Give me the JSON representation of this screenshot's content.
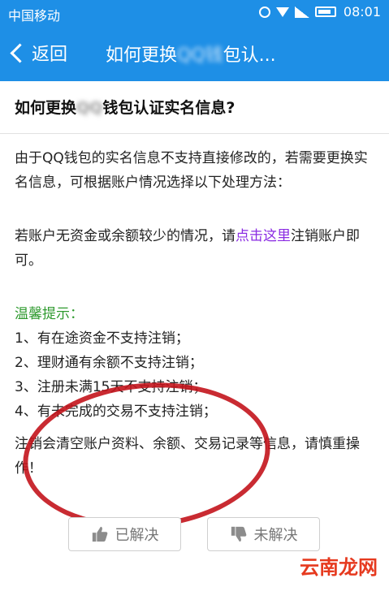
{
  "status_bar": {
    "carrier": "中国移动",
    "time": "08:01"
  },
  "nav": {
    "back_label": "返回",
    "title_pre": "如何更换",
    "title_blur": "QQ钱",
    "title_post": "包认..."
  },
  "article": {
    "title_pre": "如何更换",
    "title_blur": "QQ",
    "title_post": "钱包认证实名信息?",
    "para1": "由于QQ钱包的实名信息不支持直接修改的，若需要更换实名信息，可根据账户情况选择以下处理方法：",
    "para2_pre": "若账户无资金或余额较少的情况，请",
    "para2_link": "点击这里",
    "para2_post": "注销账户即可。",
    "tips_heading": "温馨提示：",
    "tips": [
      "1、有在途资金不支持注销；",
      "2、理财通有余额不支持注销；",
      "3、注册未满15天不支持注销；",
      "4、有未完成的交易不支持注销；"
    ],
    "warning": "注销会清空账户资料、余额、交易记录等信息，请慎重操作！"
  },
  "feedback": {
    "solved_label": "已解决",
    "unsolved_label": "未解决"
  },
  "watermark": "云南龙网"
}
